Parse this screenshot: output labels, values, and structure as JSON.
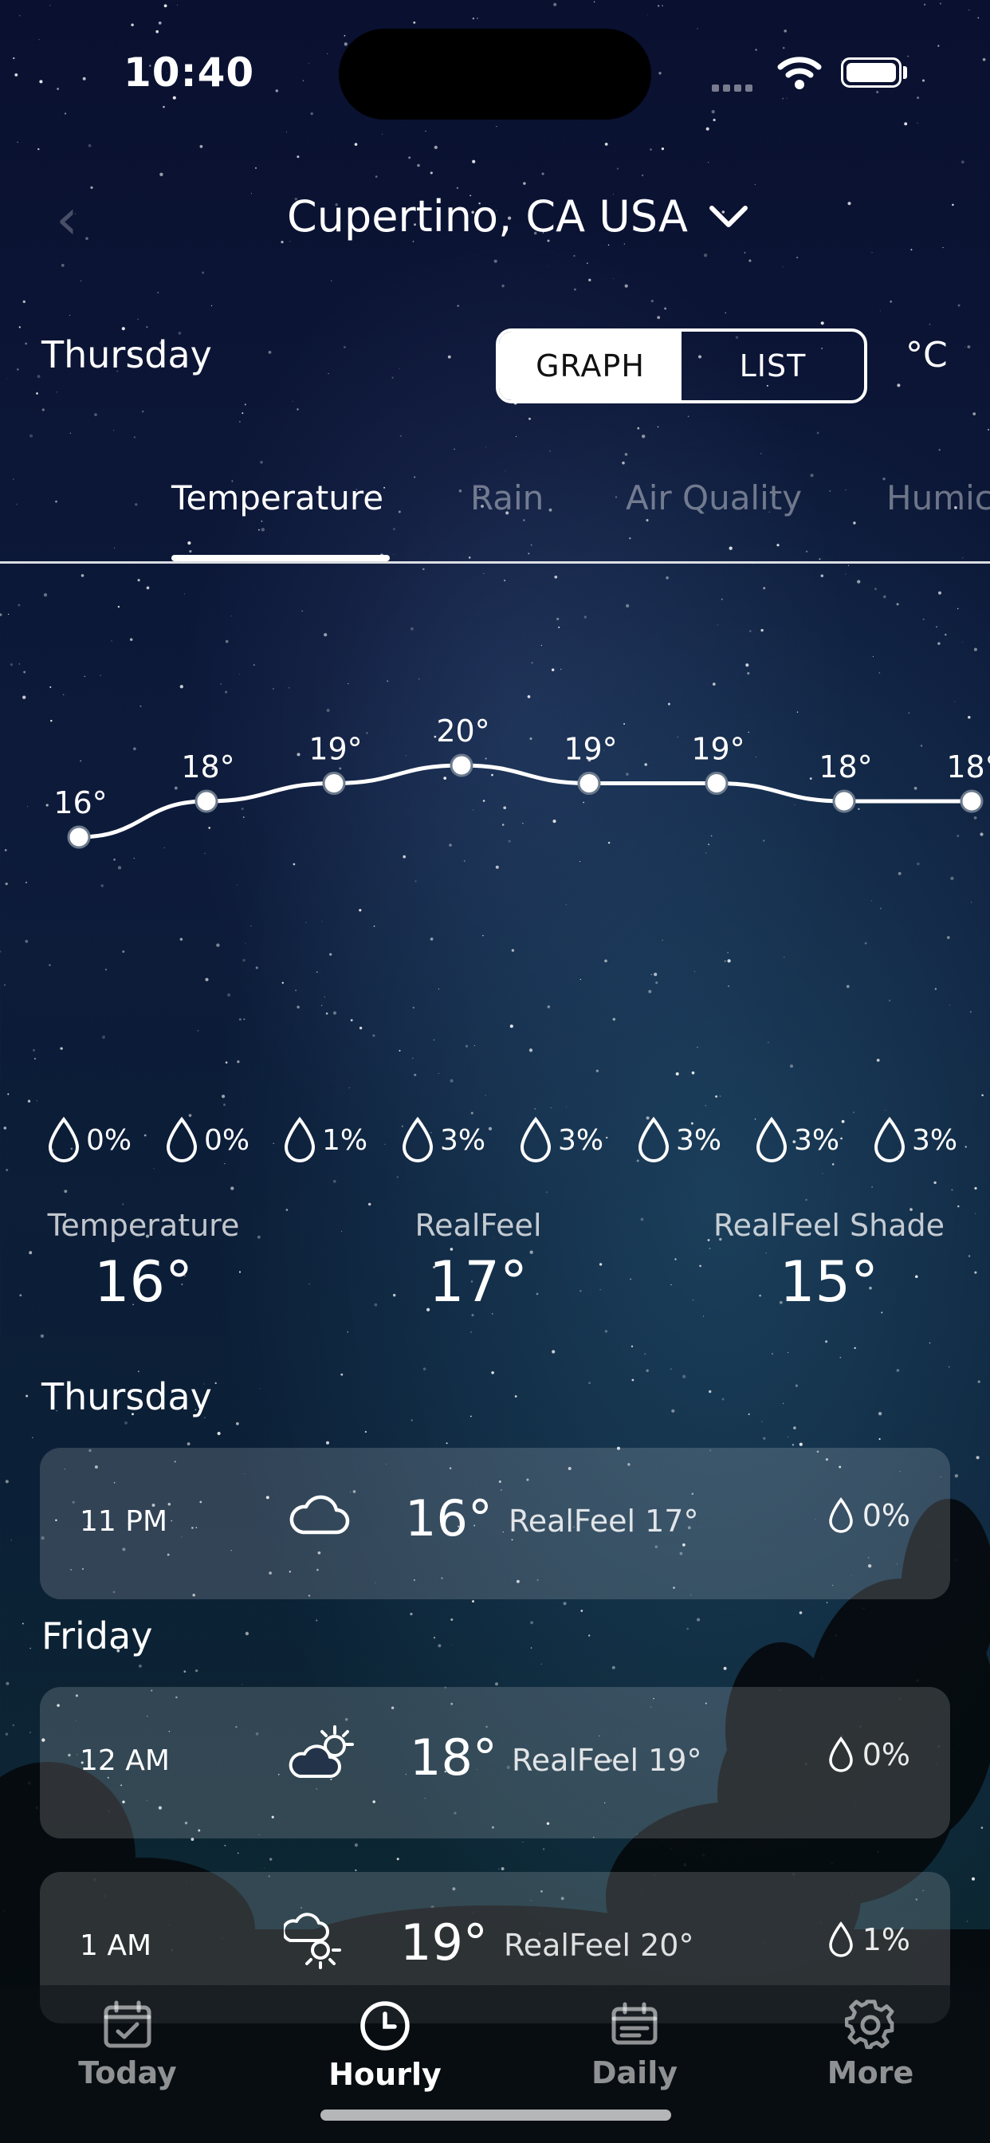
{
  "status_bar": {
    "time": "10:40"
  },
  "header": {
    "location": "Cupertino, CA USA"
  },
  "controls": {
    "day": "Thursday",
    "graph_label": "GRAPH",
    "list_label": "LIST",
    "unit": "°C"
  },
  "tabs": [
    {
      "label": "Temperature",
      "active": true
    },
    {
      "label": "Rain",
      "active": false
    },
    {
      "label": "Air Quality",
      "active": false
    },
    {
      "label": "Humic",
      "active": false
    }
  ],
  "chart_data": {
    "type": "line",
    "x": [
      0,
      1,
      2,
      3,
      4,
      5,
      6,
      7
    ],
    "values": [
      16,
      18,
      19,
      20,
      19,
      19,
      18,
      18
    ],
    "point_labels": [
      "16°",
      "18°",
      "19°",
      "20°",
      "19°",
      "19°",
      "18°",
      "18°"
    ],
    "title": "",
    "xlabel": "",
    "ylabel": ""
  },
  "rain_row": [
    "0%",
    "0%",
    "1%",
    "3%",
    "3%",
    "3%",
    "3%",
    "3%"
  ],
  "summary": {
    "temperature_label": "Temperature",
    "temperature_value": "16°",
    "realfeel_label": "RealFeel",
    "realfeel_value": "17°",
    "shade_label": "RealFeel Shade",
    "shade_value": "15°"
  },
  "sections": {
    "thursday": "Thursday",
    "friday": "Friday"
  },
  "hours": [
    {
      "time": "11 PM",
      "icon": "cloud-icon",
      "temp": "16°",
      "realfeel": "RealFeel 17°",
      "precip": "0%"
    },
    {
      "time": "12 AM",
      "icon": "partly-cloudy-icon",
      "temp": "18°",
      "realfeel": "RealFeel 19°",
      "precip": "0%"
    },
    {
      "time": "1 AM",
      "icon": "cloudy-sun-icon",
      "temp": "19°",
      "realfeel": "RealFeel 20°",
      "precip": "1%"
    }
  ],
  "tabbar": [
    {
      "label": "Today",
      "icon": "calendar-check-icon"
    },
    {
      "label": "Hourly",
      "icon": "clock-icon",
      "active": true
    },
    {
      "label": "Daily",
      "icon": "calendar-icon"
    },
    {
      "label": "More",
      "icon": "gear-icon"
    }
  ]
}
